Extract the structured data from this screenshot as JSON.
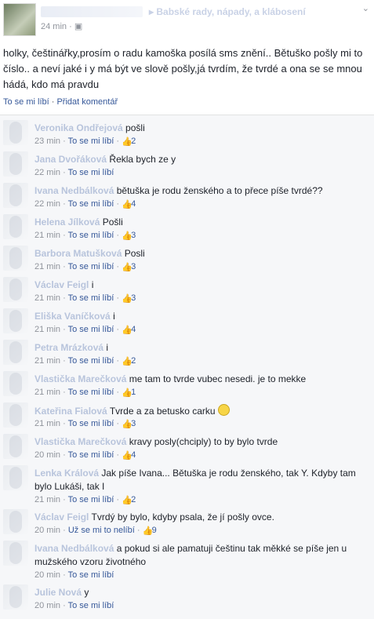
{
  "post": {
    "group_name": "Babské rady, nápady, a klábosení",
    "time": "24 min",
    "text": "holky, češtinářky,prosím o radu kamoška posílá sms znění.. Bětuško pošly mi to číslo.. a neví jaké i y má být ve slově pošly,já tvrdím, že tvrdé a ona se se mnou hádá, kdo má pravdu",
    "like_label": "To se mi líbí",
    "comment_label": "Přidat komentář"
  },
  "comments": [
    {
      "name": "Veronika Ondřejová",
      "text": "pošli",
      "time": "23 min",
      "action": "To se mi líbí",
      "likes": "2"
    },
    {
      "name": "Jana Dvořáková",
      "text": "Řekla bych ze y",
      "time": "22 min",
      "action": "To se mi líbí",
      "likes": ""
    },
    {
      "name": "Ivana Nedbálková",
      "text": "bětuška je rodu ženského a to přece píše tvrdé??",
      "time": "22 min",
      "action": "To se mi líbí",
      "likes": "4"
    },
    {
      "name": "Helena Jílková",
      "text": "Pošli",
      "time": "21 min",
      "action": "To se mi líbí",
      "likes": "3"
    },
    {
      "name": "Barbora Matušková",
      "text": "Posli",
      "time": "21 min",
      "action": "To se mi líbí",
      "likes": "3"
    },
    {
      "name": "Václav Feigl",
      "text": "i",
      "time": "21 min",
      "action": "To se mi líbí",
      "likes": "3"
    },
    {
      "name": "Eliška Vaníčková",
      "text": "i",
      "time": "21 min",
      "action": "To se mi líbí",
      "likes": "4"
    },
    {
      "name": "Petra Mrázková",
      "text": "i",
      "time": "21 min",
      "action": "To se mi líbí",
      "likes": "2"
    },
    {
      "name": "Vlastička Marečková",
      "text": "me tam to tvrde vubec nesedi. je to mekke",
      "time": "21 min",
      "action": "To se mi líbí",
      "likes": "1"
    },
    {
      "name": "Kateřina Fialová",
      "text": "Tvrde a za betusko carku",
      "time": "21 min",
      "action": "To se mi líbí",
      "likes": "3"
    },
    {
      "name": "Vlastička Marečková",
      "text": "kravy posly(chciply) to by bylo tvrde",
      "time": "20 min",
      "action": "To se mi líbí",
      "likes": "4"
    },
    {
      "name": "Lenka Králová",
      "text": "Jak píše Ivana... Bětuška je rodu ženského, tak Y. Kdyby tam bylo Lukáši, tak I",
      "time": "21 min",
      "action": "To se mi líbí",
      "likes": "2"
    },
    {
      "name": "Václav Feigl",
      "text": "Tvrdý by bylo, kdyby psala, že jí pošly ovce.",
      "time": "20 min",
      "action": "Už se mi to nelíbí",
      "likes": "9"
    },
    {
      "name": "Ivana Nedbálková",
      "text": "a pokud si ale pamatuji češtinu tak měkké se píše jen u mužského vzoru životného",
      "time": "20 min",
      "action": "To se mi líbí",
      "likes": ""
    },
    {
      "name": "Julie Nová",
      "text": "y",
      "time": "20 min",
      "action": "To se mi líbí",
      "likes": ""
    }
  ],
  "icons": {
    "like": "thumbs-up-icon",
    "globe": "audience-icon",
    "menu": "chevron-down-icon",
    "smiley": "smiley-emoji-icon"
  },
  "colors": {
    "link": "#365899",
    "meta": "#90949c",
    "like_icon": "#5890ff",
    "comments_bg": "#f6f7f9"
  }
}
